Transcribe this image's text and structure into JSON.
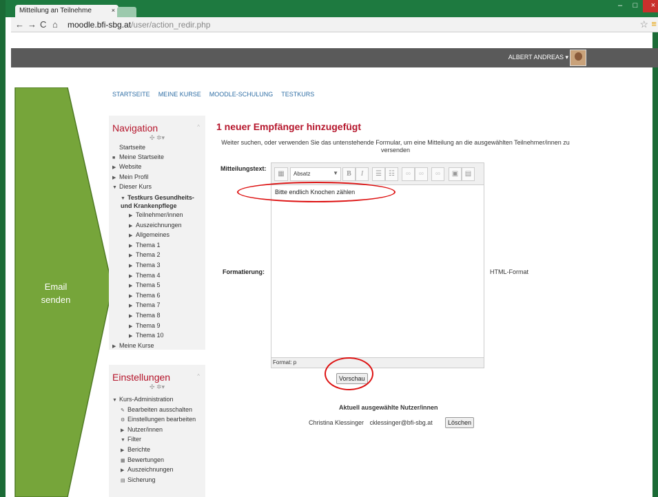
{
  "browser": {
    "tab_title": "Mitteilung an Teilnehme",
    "tab_close": "×",
    "url_host": "moodle.bfi-sbg.at",
    "url_path": "/user/action_redir.php",
    "window_buttons": [
      "–",
      "□",
      "×"
    ]
  },
  "header": {
    "user_name": "ALBERT ANDREAS"
  },
  "top_nav": [
    "STARTSEITE",
    "MEINE KURSE",
    "MOODLE-SCHULUNG",
    "TESTKURS"
  ],
  "annotation": {
    "arrow_text_line1": "Email",
    "arrow_text_line2": "senden",
    "arrow_color": "#76a53a"
  },
  "navigation_block": {
    "title": "Navigation",
    "controls": "✣ ✲▾",
    "items": [
      {
        "label": "Startseite",
        "indent": 0,
        "marker": ""
      },
      {
        "label": "Meine Startseite",
        "indent": 0,
        "marker": "■"
      },
      {
        "label": "Website",
        "indent": 0,
        "marker": "▶"
      },
      {
        "label": "Mein Profil",
        "indent": 0,
        "marker": "▶"
      },
      {
        "label": "Dieser Kurs",
        "indent": 0,
        "marker": "▼"
      },
      {
        "label": "Testkurs Gesundheits- und Krankenpflege",
        "indent": 1,
        "marker": "▼",
        "bold": true
      },
      {
        "label": "Teilnehmer/innen",
        "indent": 2,
        "marker": "▶"
      },
      {
        "label": "Auszeichnungen",
        "indent": 2,
        "marker": "▶"
      },
      {
        "label": "Allgemeines",
        "indent": 2,
        "marker": "▶"
      },
      {
        "label": "Thema 1",
        "indent": 2,
        "marker": "▶"
      },
      {
        "label": "Thema 2",
        "indent": 2,
        "marker": "▶"
      },
      {
        "label": "Thema 3",
        "indent": 2,
        "marker": "▶"
      },
      {
        "label": "Thema 4",
        "indent": 2,
        "marker": "▶"
      },
      {
        "label": "Thema 5",
        "indent": 2,
        "marker": "▶"
      },
      {
        "label": "Thema 6",
        "indent": 2,
        "marker": "▶"
      },
      {
        "label": "Thema 7",
        "indent": 2,
        "marker": "▶"
      },
      {
        "label": "Thema 8",
        "indent": 2,
        "marker": "▶"
      },
      {
        "label": "Thema 9",
        "indent": 2,
        "marker": "▶"
      },
      {
        "label": "Thema 10",
        "indent": 2,
        "marker": "▶"
      },
      {
        "label": "Meine Kurse",
        "indent": 0,
        "marker": "▶"
      }
    ]
  },
  "settings_block": {
    "title": "Einstellungen",
    "controls": "✣ ✲▾",
    "items": [
      {
        "label": "Kurs-Administration",
        "indent": 0,
        "marker": "▼"
      },
      {
        "label": "Bearbeiten ausschalten",
        "indent": 1,
        "marker": "✎"
      },
      {
        "label": "Einstellungen bearbeiten",
        "indent": 1,
        "marker": "⚙"
      },
      {
        "label": "Nutzer/innen",
        "indent": 1,
        "marker": "▶"
      },
      {
        "label": "Filter",
        "indent": 1,
        "marker": "▼"
      },
      {
        "label": "Berichte",
        "indent": 1,
        "marker": "▶"
      },
      {
        "label": "Bewertungen",
        "indent": 1,
        "marker": "▦"
      },
      {
        "label": "Auszeichnungen",
        "indent": 1,
        "marker": "▶"
      },
      {
        "label": "Sicherung",
        "indent": 1,
        "marker": "▤"
      }
    ]
  },
  "main": {
    "title": "1 neuer Empfänger hinzugefügt",
    "description": "Weiter suchen, oder verwenden Sie das untenstehende Formular, um eine Mitteilung an die ausgewählten Teilnehmer/innen zu versenden",
    "message_label": "Mitteilungstext:",
    "format_label": "Formatierung:",
    "format_value": "HTML-Format",
    "editor": {
      "paragraph_select": "Absatz",
      "content": "Bitte endlich Knochen zählen",
      "status": "Format: p"
    },
    "preview_button": "Vorschau",
    "selected_title": "Aktuell ausgewählte Nutzer/innen",
    "selected_user": {
      "name": "Christina Klessinger",
      "email": "cklessinger@bfi-sbg.at",
      "delete_button": "Löschen"
    }
  },
  "highlight_color": "#dd1111"
}
